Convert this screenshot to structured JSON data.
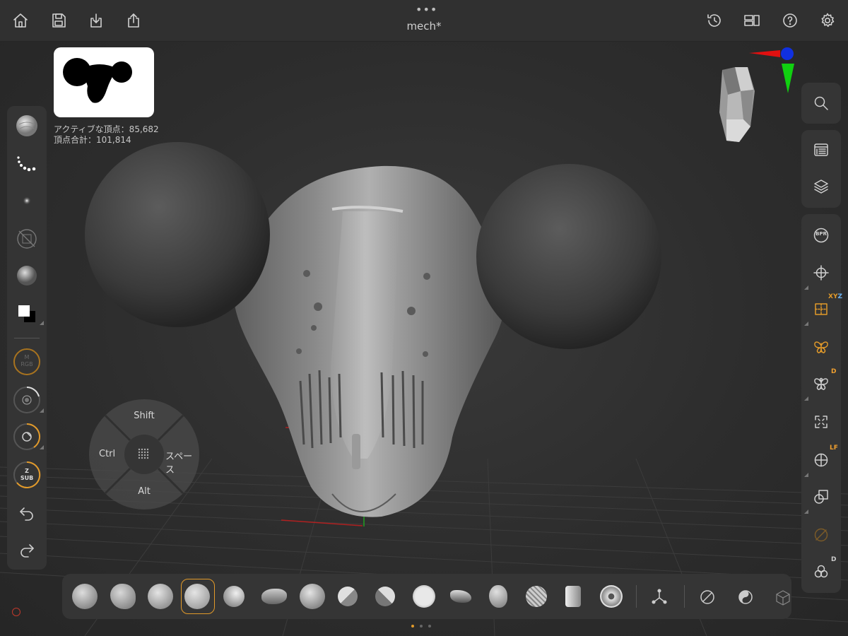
{
  "app": {
    "document_title": "mech*"
  },
  "stats": {
    "active_vertices": "アクティブな頂点：85,682",
    "total_vertices": "頂点合計：101,814"
  },
  "pad": {
    "top": "Shift",
    "left": "Ctrl",
    "right": "スペース",
    "bottom": "Alt"
  },
  "left_toolbar": {
    "rgb_label_1": "M",
    "rgb_label_2": "RGB",
    "zsub_label_1": "Z",
    "zsub_label_2": "SUB"
  },
  "right_toolbar": {
    "bpr_label": "BPR",
    "xyz_label_x": "X",
    "xyz_label_y": "Y",
    "xyz_label_z": "Z",
    "symmetry_d": "D",
    "lf_label": "LF",
    "subtool_d": "D"
  },
  "colors": {
    "accent": "#e29a2a",
    "axis_x": "#e01010",
    "axis_y": "#10d010",
    "axis_z": "#1030e0"
  },
  "bottom_toolbar": {
    "brushes": [
      "clay-buildup",
      "clay-tubes",
      "standard",
      "move",
      "inflate",
      "damstandard",
      "snakehook",
      "hpolish",
      "trimdynamic",
      "smooth",
      "orbit",
      "pinch",
      "imm-curve",
      "chisel",
      "slash"
    ],
    "selected_index": 3
  },
  "page_indicator": {
    "count": 3,
    "active": 0
  }
}
